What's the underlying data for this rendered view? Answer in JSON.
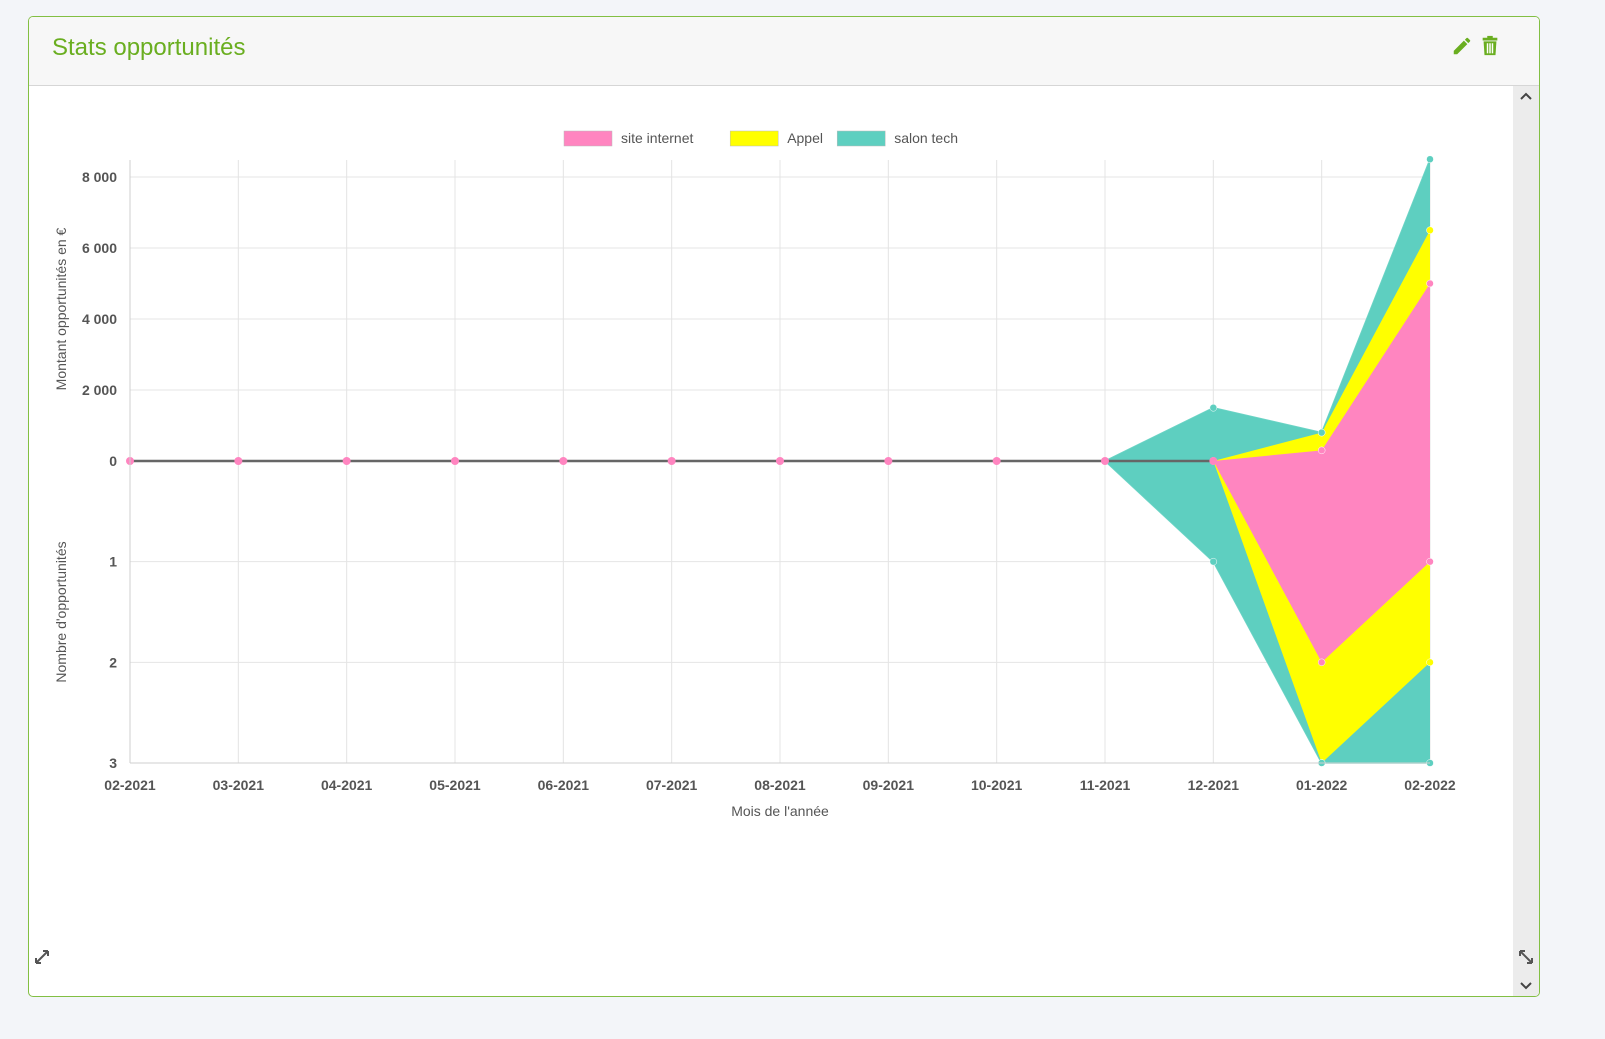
{
  "widget": {
    "title": "Stats opportunités",
    "edit_icon": "pencil-icon",
    "delete_icon": "trash-icon",
    "accent_color": "#6aae20"
  },
  "chart_data": {
    "type": "area",
    "stacked": true,
    "legend_position": "top",
    "grid": true,
    "xlabel": "Mois de l'année",
    "categories": [
      "02-2021",
      "03-2021",
      "04-2021",
      "05-2021",
      "06-2021",
      "07-2021",
      "08-2021",
      "09-2021",
      "10-2021",
      "11-2021",
      "12-2021",
      "01-2022",
      "02-2022"
    ],
    "legend": [
      {
        "name": "site internet",
        "color": "#ff85c0"
      },
      {
        "name": "Appel",
        "color": "#ffff00"
      },
      {
        "name": "salon tech",
        "color": "#5ecfc0"
      }
    ],
    "top_axis": {
      "ylabel": "Montant opportunités en €",
      "ylim": [
        0,
        8000
      ],
      "ticks": [
        "0",
        "2 000",
        "4 000",
        "6 000",
        "8 000"
      ],
      "tick_values": [
        0,
        2000,
        4000,
        6000,
        8000
      ],
      "series": [
        {
          "name": "site internet",
          "values": [
            0,
            0,
            0,
            0,
            0,
            0,
            0,
            0,
            0,
            0,
            0,
            300,
            5000
          ]
        },
        {
          "name": "Appel",
          "values": [
            0,
            0,
            0,
            0,
            0,
            0,
            0,
            0,
            0,
            0,
            0,
            500,
            1500
          ]
        },
        {
          "name": "salon tech",
          "values": [
            0,
            0,
            0,
            0,
            0,
            0,
            0,
            0,
            0,
            0,
            1500,
            0,
            2000
          ]
        }
      ]
    },
    "bottom_axis": {
      "ylabel": "Nombre d'opportunités",
      "ylim": [
        0,
        3
      ],
      "ticks": [
        "1",
        "2",
        "3"
      ],
      "tick_values": [
        1,
        2,
        3
      ],
      "series": [
        {
          "name": "site internet",
          "values": [
            0,
            0,
            0,
            0,
            0,
            0,
            0,
            0,
            0,
            0,
            0,
            2,
            1
          ]
        },
        {
          "name": "Appel",
          "values": [
            0,
            0,
            0,
            0,
            0,
            0,
            0,
            0,
            0,
            0,
            0,
            1,
            1
          ]
        },
        {
          "name": "salon tech",
          "values": [
            0,
            0,
            0,
            0,
            0,
            0,
            0,
            0,
            0,
            0,
            1,
            0,
            1
          ]
        }
      ]
    }
  }
}
